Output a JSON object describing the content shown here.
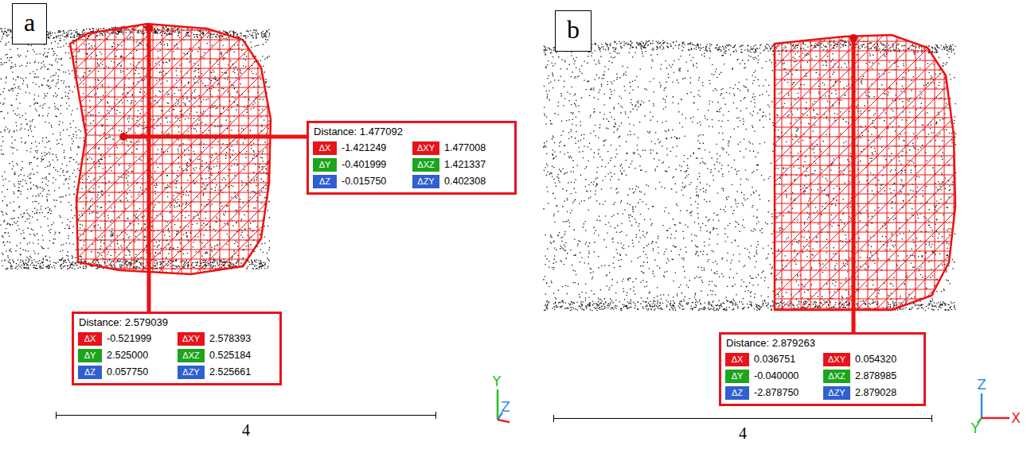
{
  "panels": [
    {
      "label": "a",
      "measurements": [
        {
          "title": "Distance: 1.477092",
          "cells": [
            {
              "key": "ΔX",
              "value": "-1.421249",
              "color": "#e8131a"
            },
            {
              "key": "ΔXY",
              "value": "1.477008",
              "color": "#e8131a"
            },
            {
              "key": "ΔY",
              "value": "-0.401999",
              "color": "#1ca51c"
            },
            {
              "key": "ΔXZ",
              "value": "1.421337",
              "color": "#1ca51c"
            },
            {
              "key": "ΔZ",
              "value": "-0.015750",
              "color": "#2f5fd0"
            },
            {
              "key": "ΔZY",
              "value": "0.402308",
              "color": "#2f5fd0"
            }
          ]
        },
        {
          "title": "Distance: 2.579039",
          "cells": [
            {
              "key": "ΔX",
              "value": "-0.521999",
              "color": "#e8131a"
            },
            {
              "key": "ΔXY",
              "value": "2.578393",
              "color": "#e8131a"
            },
            {
              "key": "ΔY",
              "value": "2.525000",
              "color": "#1ca51c"
            },
            {
              "key": "ΔXZ",
              "value": "0.525184",
              "color": "#1ca51c"
            },
            {
              "key": "ΔZ",
              "value": "0.057750",
              "color": "#2f5fd0"
            },
            {
              "key": "ΔZY",
              "value": "2.525661",
              "color": "#2f5fd0"
            }
          ]
        }
      ],
      "axes": [
        {
          "label": "Y",
          "color": "#22c022"
        },
        {
          "label": "Z",
          "color": "#2a8ee8"
        },
        {
          "label": "X",
          "color": "#e8202a"
        }
      ],
      "scale": "4"
    },
    {
      "label": "b",
      "measurements": [
        {
          "title": "Distance: 2.879263",
          "cells": [
            {
              "key": "ΔX",
              "value": "0.036751",
              "color": "#e8131a"
            },
            {
              "key": "ΔXY",
              "value": "0.054320",
              "color": "#e8131a"
            },
            {
              "key": "ΔY",
              "value": "-0.040000",
              "color": "#1ca51c"
            },
            {
              "key": "ΔXZ",
              "value": "2.878985",
              "color": "#1ca51c"
            },
            {
              "key": "ΔZ",
              "value": "-2.878750",
              "color": "#2f5fd0"
            },
            {
              "key": "ΔZY",
              "value": "2.879028",
              "color": "#2f5fd0"
            }
          ]
        }
      ],
      "axes": [
        {
          "label": "Z",
          "color": "#2a8ee8"
        },
        {
          "label": "Y",
          "color": "#22c022"
        },
        {
          "label": "X",
          "color": "#e8202a"
        }
      ],
      "scale": "4"
    }
  ]
}
